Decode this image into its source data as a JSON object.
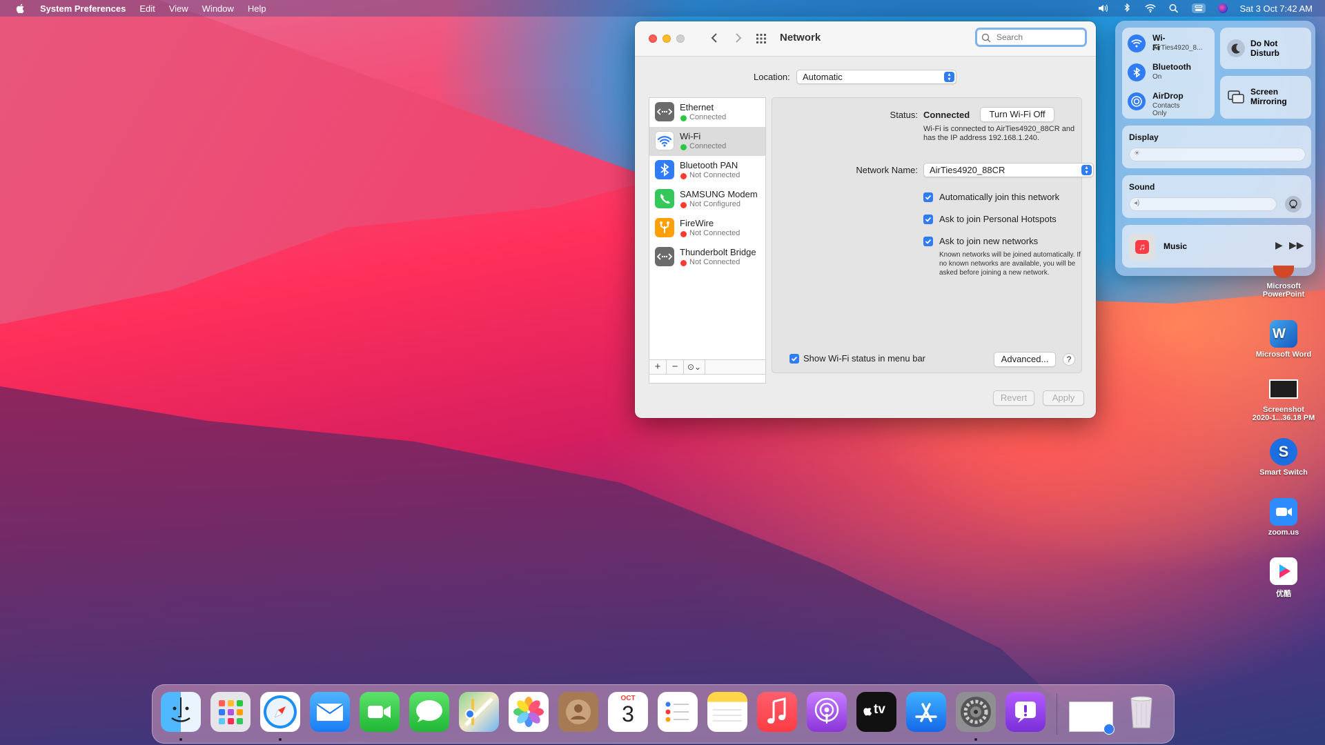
{
  "menubar": {
    "app_name": "System Preferences",
    "menus": [
      "Edit",
      "View",
      "Window",
      "Help"
    ],
    "datetime": "Sat 3 Oct  7:42 AM"
  },
  "window": {
    "title": "Network",
    "search_placeholder": "Search",
    "location_label": "Location:",
    "location_value": "Automatic",
    "services": [
      {
        "name": "Ethernet",
        "status": "Connected",
        "status_color": "#28c840"
      },
      {
        "name": "Wi-Fi",
        "status": "Connected",
        "status_color": "#28c840"
      },
      {
        "name": "Bluetooth PAN",
        "status": "Not Connected",
        "status_color": "#ff3b30"
      },
      {
        "name": "SAMSUNG Modem",
        "status": "Not Configured",
        "status_color": "#ff3b30"
      },
      {
        "name": "FireWire",
        "status": "Not Connected",
        "status_color": "#ff3b30"
      },
      {
        "name": "Thunderbolt Bridge",
        "status": "Not Connected",
        "status_color": "#ff3b30"
      }
    ],
    "status_label": "Status:",
    "status_value": "Connected",
    "turn_off_button": "Turn Wi-Fi Off",
    "status_desc_1": "Wi-Fi is connected to AirTies4920_88CR and",
    "status_desc_2": "has the IP address 192.168.1.240.",
    "network_name_label": "Network Name:",
    "network_name_value": "AirTies4920_88CR",
    "checkbox_auto_join": "Automatically join this network",
    "checkbox_hotspots": "Ask to join Personal Hotspots",
    "checkbox_new_networks": "Ask to join new networks",
    "new_networks_note_1": "Known networks will be joined automatically. If",
    "new_networks_note_2": "no known networks are available, you will be",
    "new_networks_note_3": "asked before joining a new network.",
    "show_status_label": "Show Wi-Fi status in menu bar",
    "advanced_button": "Advanced...",
    "help_button": "?",
    "revert_button": "Revert",
    "apply_button": "Apply"
  },
  "control_center": {
    "wifi_title": "Wi-Fi",
    "wifi_sub": "AirTies4920_8...",
    "bluetooth_title": "Bluetooth",
    "bluetooth_sub": "On",
    "airdrop_title": "AirDrop",
    "airdrop_sub": "Contacts Only",
    "dnd_line1": "Do Not",
    "dnd_line2": "Disturb",
    "mirroring_line1": "Screen",
    "mirroring_line2": "Mirroring",
    "display_label": "Display",
    "sound_label": "Sound",
    "music_label": "Music"
  },
  "desktop_icons": [
    {
      "line1": "Microsoft",
      "line2": "PowerPoint"
    },
    {
      "line1": "Microsoft Word",
      "line2": ""
    },
    {
      "line1": "Screenshot",
      "line2": "2020-1...36.18 PM"
    },
    {
      "line1": "Smart Switch",
      "line2": ""
    },
    {
      "line1": "zoom.us",
      "line2": ""
    },
    {
      "line1": "优酷",
      "line2": ""
    }
  ],
  "dock": {
    "apps": [
      "finder",
      "launchpad",
      "safari",
      "mail",
      "facetime",
      "messages",
      "maps",
      "photos",
      "contacts",
      "calendar",
      "reminders",
      "notes",
      "music",
      "podcasts",
      "tv",
      "app-store",
      "system-preferences",
      "feedback-assistant"
    ],
    "calendar_month": "OCT",
    "calendar_day": "3",
    "tv_label": "tv"
  }
}
